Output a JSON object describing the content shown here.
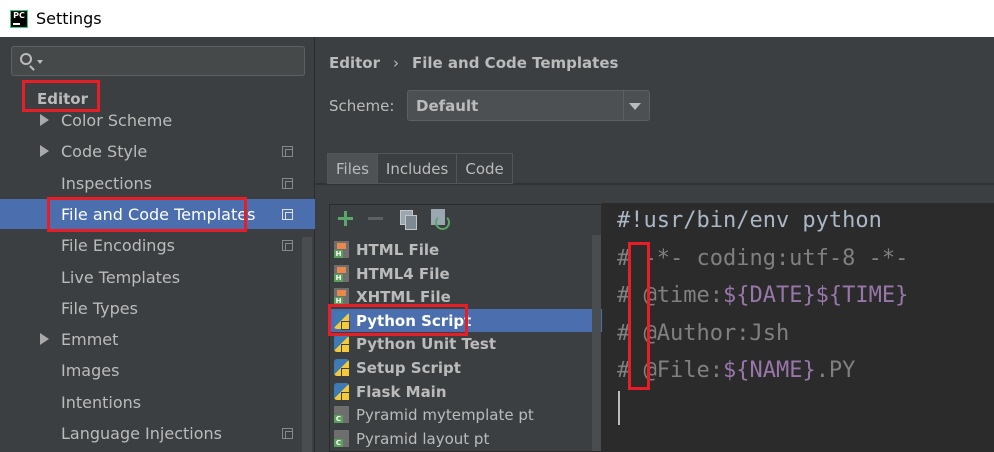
{
  "window": {
    "title": "Settings"
  },
  "sidebar": {
    "search_placeholder": "",
    "heading": "Editor",
    "items": [
      {
        "label": "Color Scheme",
        "expandable": true,
        "has_copy_icon": false,
        "selected": false
      },
      {
        "label": "Code Style",
        "expandable": true,
        "has_copy_icon": true,
        "selected": false
      },
      {
        "label": "Inspections",
        "expandable": false,
        "has_copy_icon": true,
        "selected": false
      },
      {
        "label": "File and Code Templates",
        "expandable": false,
        "has_copy_icon": true,
        "selected": true
      },
      {
        "label": "File Encodings",
        "expandable": false,
        "has_copy_icon": true,
        "selected": false
      },
      {
        "label": "Live Templates",
        "expandable": false,
        "has_copy_icon": false,
        "selected": false
      },
      {
        "label": "File Types",
        "expandable": false,
        "has_copy_icon": false,
        "selected": false
      },
      {
        "label": "Emmet",
        "expandable": true,
        "has_copy_icon": false,
        "selected": false
      },
      {
        "label": "Images",
        "expandable": false,
        "has_copy_icon": false,
        "selected": false
      },
      {
        "label": "Intentions",
        "expandable": false,
        "has_copy_icon": false,
        "selected": false
      },
      {
        "label": "Language Injections",
        "expandable": false,
        "has_copy_icon": true,
        "selected": false
      }
    ]
  },
  "breadcrumb": {
    "parent": "Editor",
    "separator": "›",
    "current": "File and Code Templates"
  },
  "scheme": {
    "label": "Scheme:",
    "value": "Default"
  },
  "tabs": [
    {
      "label": "Files",
      "active": true
    },
    {
      "label": "Includes",
      "active": false
    },
    {
      "label": "Code",
      "active": false
    }
  ],
  "toolbar": {
    "icons": [
      "add-icon",
      "remove-icon",
      "copy-icon",
      "reset-icon"
    ]
  },
  "templates": [
    {
      "name": "HTML File",
      "icon": "html-file-icon",
      "bold": true,
      "selected": false
    },
    {
      "name": "HTML4 File",
      "icon": "html-file-icon",
      "bold": true,
      "selected": false
    },
    {
      "name": "XHTML File",
      "icon": "html-file-icon",
      "bold": true,
      "selected": false
    },
    {
      "name": "Python Script",
      "icon": "python-file-icon",
      "bold": true,
      "selected": true
    },
    {
      "name": "Python Unit Test",
      "icon": "python-file-icon",
      "bold": true,
      "selected": false
    },
    {
      "name": "Setup Script",
      "icon": "python-file-icon",
      "bold": true,
      "selected": false
    },
    {
      "name": "Flask Main",
      "icon": "python-file-icon",
      "bold": true,
      "selected": false
    },
    {
      "name": "Pyramid mytemplate pt",
      "icon": "pt-file-icon",
      "bold": false,
      "selected": false
    },
    {
      "name": "Pyramid layout pt",
      "icon": "pt-file-icon",
      "bold": false,
      "selected": false
    }
  ],
  "editor": {
    "lines": [
      {
        "segments": [
          {
            "text": "#!usr/bin/env python",
            "style": "plain"
          }
        ]
      },
      {
        "segments": [
          {
            "text": "# -*- coding:utf-8 -*-",
            "style": "comment"
          }
        ]
      },
      {
        "segments": [
          {
            "text": "# @time:",
            "style": "comment"
          },
          {
            "text": "${DATE}${TIME}",
            "style": "var"
          }
        ]
      },
      {
        "segments": [
          {
            "text": "# @Author:Jsh",
            "style": "comment"
          }
        ]
      },
      {
        "segments": [
          {
            "text": "# @File:",
            "style": "comment"
          },
          {
            "text": "${NAME}",
            "style": "var"
          },
          {
            "text": ".PY",
            "style": "comment"
          }
        ]
      }
    ]
  },
  "colors": {
    "selection": "#4b6eaf",
    "highlight_box": "#e81e26",
    "panel_bg": "#3c3f41",
    "editor_bg": "#2b2b2b",
    "template_var": "#9876aa"
  }
}
